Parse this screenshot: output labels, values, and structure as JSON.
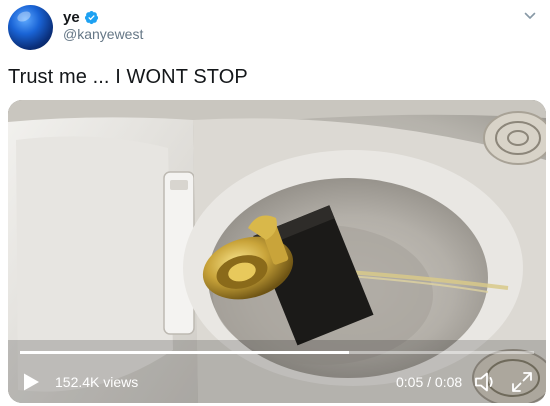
{
  "tweet": {
    "display_name": "ye",
    "handle": "@kanyewest",
    "verified": true,
    "text": "Trust me ... I WONT STOP"
  },
  "video": {
    "views": "152.4K views",
    "time": "0:05 / 0:08",
    "progress_fraction": 0.64
  },
  "icons": {
    "avatar": "avatar",
    "verified": "verified-badge-icon",
    "menu": "chevron-down-icon",
    "play": "play-icon",
    "volume": "volume-icon",
    "fullscreen": "fullscreen-icon"
  },
  "colors": {
    "verified_blue": "#1da1f2",
    "handle_gray": "#657786",
    "text": "#14171a"
  }
}
